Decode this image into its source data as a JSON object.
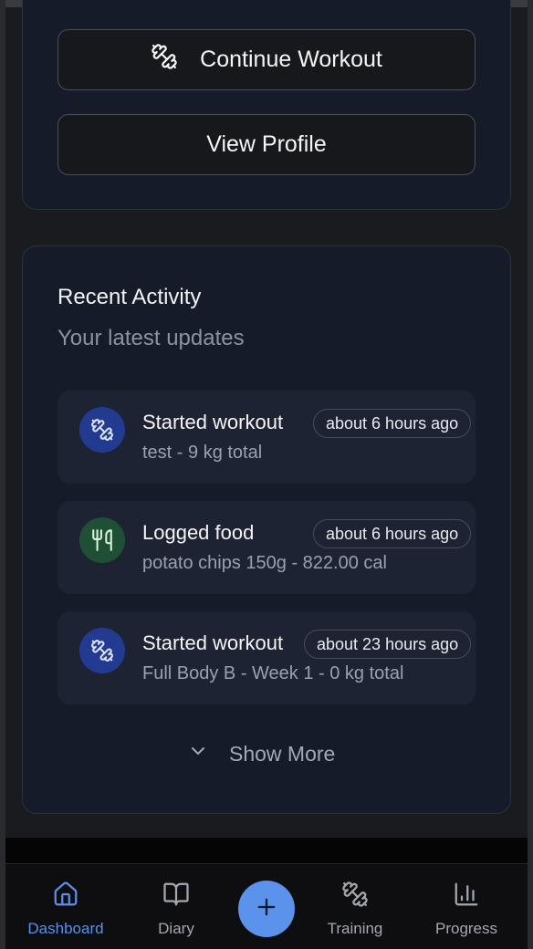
{
  "actions": {
    "continue_label": "Continue Workout",
    "profile_label": "View Profile"
  },
  "activity": {
    "title": "Recent Activity",
    "subtitle": "Your latest updates",
    "items": [
      {
        "icon": "dumbbell-icon",
        "title": "Started workout",
        "detail": "test - 9 kg total",
        "time": "about 6 hours ago"
      },
      {
        "icon": "utensils-icon",
        "title": "Logged food",
        "detail": "potato chips 150g - 822.00 cal",
        "time": "about 6 hours ago"
      },
      {
        "icon": "dumbbell-icon",
        "title": "Started workout",
        "detail": "Full Body B - Week 1 - 0 kg total",
        "time": "about 23 hours ago"
      }
    ],
    "show_more_label": "Show More"
  },
  "nav": {
    "items": [
      {
        "label": "Dashboard",
        "icon": "home-icon",
        "active": true
      },
      {
        "label": "Diary",
        "icon": "book-icon"
      },
      {
        "label": "Training",
        "icon": "dumbbell-icon"
      },
      {
        "label": "Progress",
        "icon": "bar-chart-icon"
      }
    ],
    "add_icon": "plus-icon"
  },
  "colors": {
    "accent": "#5a92ec",
    "card_bg": "#151b29",
    "item_bg": "#1d2333",
    "workout_icon_bg": "#223a8f",
    "food_icon_bg": "#1f4f34"
  }
}
